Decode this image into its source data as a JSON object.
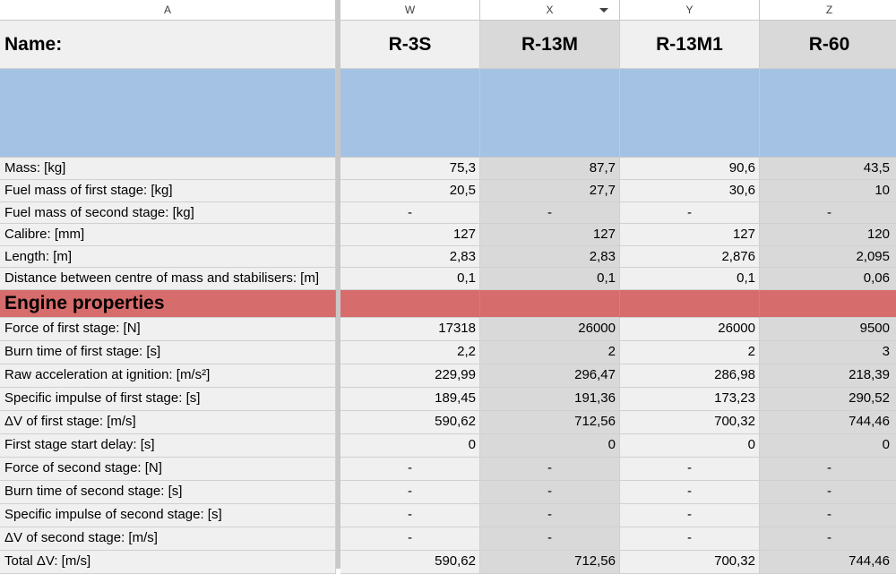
{
  "columns": {
    "a": "A",
    "w": "W",
    "x": "X",
    "y": "Y",
    "z": "Z"
  },
  "name_row": {
    "label": "Name:",
    "values": [
      "R-3S",
      "R-13M",
      "R-13M1",
      "R-60"
    ]
  },
  "section_engine": "Engine properties",
  "rows_general": [
    {
      "label": "Mass: [kg]",
      "values": [
        "75,3",
        "87,7",
        "90,6",
        "43,5"
      ]
    },
    {
      "label": "Fuel mass of first stage: [kg]",
      "values": [
        "20,5",
        "27,7",
        "30,6",
        "10"
      ]
    },
    {
      "label": "Fuel mass of second stage: [kg]",
      "values": [
        "-",
        "-",
        "-",
        "-"
      ]
    },
    {
      "label": "Calibre: [mm]",
      "values": [
        "127",
        "127",
        "127",
        "120"
      ]
    },
    {
      "label": "Length: [m]",
      "values": [
        "2,83",
        "2,83",
        "2,876",
        "2,095"
      ]
    },
    {
      "label": "Distance between centre of mass and stabilisers: [m]",
      "values": [
        "0,1",
        "0,1",
        "0,1",
        "0,06"
      ]
    }
  ],
  "rows_engine": [
    {
      "label": "Force of first stage: [N]",
      "values": [
        "17318",
        "26000",
        "26000",
        "9500"
      ]
    },
    {
      "label": "Burn time of first stage: [s]",
      "values": [
        "2,2",
        "2",
        "2",
        "3"
      ]
    },
    {
      "label": "Raw acceleration at ignition: [m/s²]",
      "values": [
        "229,99",
        "296,47",
        "286,98",
        "218,39"
      ]
    },
    {
      "label": "Specific impulse of first stage: [s]",
      "values": [
        "189,45",
        "191,36",
        "173,23",
        "290,52"
      ]
    },
    {
      "label": "ΔV of first stage: [m/s]",
      "values": [
        "590,62",
        "712,56",
        "700,32",
        "744,46"
      ]
    },
    {
      "label": "First stage start delay: [s]",
      "values": [
        "0",
        "0",
        "0",
        "0"
      ]
    },
    {
      "label": "Force of second stage: [N]",
      "values": [
        "-",
        "-",
        "-",
        "-"
      ]
    },
    {
      "label": "Burn time of second stage: [s]",
      "values": [
        "-",
        "-",
        "-",
        "-"
      ]
    },
    {
      "label": "Specific impulse of second stage: [s]",
      "values": [
        "-",
        "-",
        "-",
        "-"
      ]
    },
    {
      "label": "ΔV of second stage: [m/s]",
      "values": [
        "-",
        "-",
        "-",
        "-"
      ]
    },
    {
      "label": "Total ΔV: [m/s]",
      "values": [
        "590,62",
        "712,56",
        "700,32",
        "744,46"
      ]
    }
  ]
}
